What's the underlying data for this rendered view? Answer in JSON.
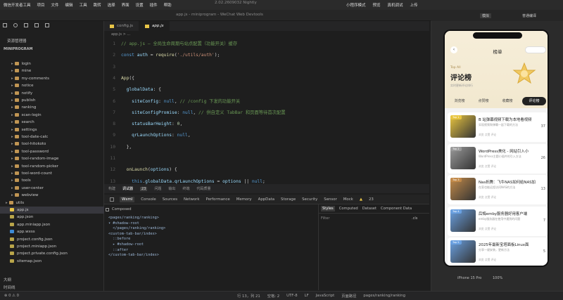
{
  "menubar": {
    "items": [
      "微信开发者工具",
      "项目",
      "文件",
      "编辑",
      "工具",
      "跳转",
      "选择",
      "界面",
      "设置",
      "插件",
      "帮助"
    ],
    "version": "2.02.2609032 Nightly",
    "right": [
      "小程序模式",
      "预览",
      "真机调试",
      "上传"
    ]
  },
  "titlebar": {
    "title": "app.js - miniprogram - WeChat Web Devtools"
  },
  "sim_header": {
    "mode": "模拟",
    "compile": "普通编译"
  },
  "explorer": {
    "title": "资源管理器",
    "root": "MINIPROGRAM",
    "items": [
      {
        "label": "login",
        "type": "folder"
      },
      {
        "label": "mine",
        "type": "folder"
      },
      {
        "label": "my-comments",
        "type": "folder"
      },
      {
        "label": "notice",
        "type": "folder"
      },
      {
        "label": "notify",
        "type": "folder"
      },
      {
        "label": "publish",
        "type": "folder"
      },
      {
        "label": "ranking",
        "type": "folder"
      },
      {
        "label": "scan-login",
        "type": "folder"
      },
      {
        "label": "search",
        "type": "folder"
      },
      {
        "label": "settings",
        "type": "folder"
      },
      {
        "label": "tool-date-calc",
        "type": "folder"
      },
      {
        "label": "tool-hitokoto",
        "type": "folder"
      },
      {
        "label": "tool-password",
        "type": "folder"
      },
      {
        "label": "tool-random-image",
        "type": "folder"
      },
      {
        "label": "tool-random-picker",
        "type": "folder"
      },
      {
        "label": "tool-word-count",
        "type": "folder"
      },
      {
        "label": "tools",
        "type": "folder"
      },
      {
        "label": "user-center",
        "type": "folder"
      },
      {
        "label": "webview",
        "type": "folder"
      },
      {
        "label": "utils",
        "type": "folder"
      },
      {
        "label": "app.js",
        "type": "file"
      },
      {
        "label": "app.json",
        "type": "json"
      },
      {
        "label": "app.miniapp.json",
        "type": "json"
      },
      {
        "label": "app.wxss",
        "type": "wxss"
      },
      {
        "label": "project.config.json",
        "type": "json"
      },
      {
        "label": "project.miniapp.json",
        "type": "json"
      },
      {
        "label": "project.private.config.json",
        "type": "json"
      },
      {
        "label": "sitemap.json",
        "type": "json"
      }
    ],
    "outline": "大纲",
    "timeline": "时间线"
  },
  "editor": {
    "tabs": [
      {
        "label": "config.js"
      },
      {
        "label": "app.js"
      }
    ],
    "breadcrumb": "app.js > ...",
    "lines": [
      {
        "n": "1",
        "parts": [
          [
            "c-com",
            "// app.js — 全局生命周期与站点配置（功能开关）缓存"
          ]
        ]
      },
      {
        "n": "2",
        "parts": [
          [
            "c-kw",
            "const "
          ],
          [
            "c-prop",
            "auth"
          ],
          [
            "c-txt",
            " = "
          ],
          [
            "c-fn",
            "require"
          ],
          [
            "c-txt",
            "("
          ],
          [
            "c-str",
            "'./utils/auth'"
          ],
          [
            "c-txt",
            ");"
          ]
        ]
      },
      {
        "n": "3",
        "parts": []
      },
      {
        "n": "4",
        "parts": [
          [
            "c-fn",
            "App"
          ],
          [
            "c-txt",
            "({"
          ]
        ]
      },
      {
        "n": "5",
        "parts": [
          [
            "c-txt",
            "  "
          ],
          [
            "c-prop",
            "globalData"
          ],
          [
            "c-txt",
            ": {"
          ]
        ]
      },
      {
        "n": "6",
        "parts": [
          [
            "c-txt",
            "    "
          ],
          [
            "c-prop",
            "siteConfig"
          ],
          [
            "c-txt",
            ": "
          ],
          [
            "c-kw",
            "null"
          ],
          [
            "c-txt",
            ", "
          ],
          [
            "c-com",
            "// /config 下发的功能开关"
          ]
        ]
      },
      {
        "n": "7",
        "parts": [
          [
            "c-txt",
            "    "
          ],
          [
            "c-prop",
            "siteConfigPromise"
          ],
          [
            "c-txt",
            ": "
          ],
          [
            "c-kw",
            "null"
          ],
          [
            "c-txt",
            ", "
          ],
          [
            "c-com",
            "// 供自定义 TabBar 和页面等待首次配置"
          ]
        ]
      },
      {
        "n": "8",
        "parts": [
          [
            "c-txt",
            "    "
          ],
          [
            "c-prop",
            "statusBarHeight"
          ],
          [
            "c-txt",
            ": "
          ],
          [
            "c-num",
            "0"
          ],
          [
            "c-txt",
            ","
          ]
        ]
      },
      {
        "n": "9",
        "parts": [
          [
            "c-txt",
            "    "
          ],
          [
            "c-prop",
            "qrLaunchOptions"
          ],
          [
            "c-txt",
            ": "
          ],
          [
            "c-kw",
            "null"
          ],
          [
            "c-txt",
            ","
          ]
        ]
      },
      {
        "n": "10",
        "parts": [
          [
            "c-txt",
            "  },"
          ]
        ]
      },
      {
        "n": "11",
        "parts": []
      },
      {
        "n": "12",
        "parts": [
          [
            "c-txt",
            "  "
          ],
          [
            "c-fn",
            "onLaunch"
          ],
          [
            "c-txt",
            "("
          ],
          [
            "c-prop",
            "options"
          ],
          [
            "c-txt",
            ") {"
          ]
        ]
      },
      {
        "n": "13",
        "parts": [
          [
            "c-txt",
            "    "
          ],
          [
            "c-kw",
            "this"
          ],
          [
            "c-txt",
            "."
          ],
          [
            "c-prop",
            "globalData"
          ],
          [
            "c-txt",
            "."
          ],
          [
            "c-prop",
            "qrLaunchOptions"
          ],
          [
            "c-txt",
            " = "
          ],
          [
            "c-prop",
            "options"
          ],
          [
            "c-txt",
            " || "
          ],
          [
            "c-kw",
            "null"
          ],
          [
            "c-txt",
            ";"
          ]
        ]
      }
    ]
  },
  "panel": {
    "tabs": [
      "构建",
      "调试器",
      "23",
      "问题",
      "输出",
      "终端",
      "代码质量"
    ],
    "devtabs": [
      "Wxml",
      "Console",
      "Sources",
      "Network",
      "Performance",
      "Memory",
      "AppData",
      "Storage",
      "Security",
      "Sensor",
      "Mock"
    ],
    "warn_count": "23",
    "composed": "Composed",
    "wxml_lines": [
      "<pages/ranking/ranking>",
      "▾ #shadow-root",
      "  </pages/ranking/ranking>",
      "<custom-tab-bar/index>",
      "  ::before",
      "  ▸ #shadow-root",
      "  ::after",
      "</custom-tab-bar/index>"
    ],
    "style_tabs": [
      "Styles",
      "Computed",
      "Dataset",
      "Component Data"
    ],
    "filter": "Filter",
    "cls": ".cls"
  },
  "statusbar": {
    "items": [
      "⊗ 0 ⚠ 0",
      "行 13，列 21",
      "空格: 2",
      "UTF-8",
      "LF",
      "JavaScript",
      "页面路径",
      "pages/ranking/ranking"
    ]
  },
  "phone": {
    "nav_title": "榜单",
    "hero_sub": "Top All",
    "hero_title": "评论榜",
    "hero_desc": "实时更新评论排行",
    "tabs": [
      "浏览榜",
      "点赞榜",
      "收藏榜",
      "评论榜"
    ],
    "cards": [
      {
        "badge": "Top 1",
        "title": "B 站弹幕视频下载为本地看视频",
        "desc": "实现视频和弹幕一起下载的方法",
        "meta": "浏览 点赞 评论",
        "num": "37",
        "color": "#e8c540"
      },
      {
        "badge": "Top 2",
        "title": "WordPress美化 - 网站引入小",
        "desc": "WordPress主题小插件的引入方法",
        "meta": "浏览 点赞 评论",
        "num": "26",
        "color": "#9a9a9a"
      },
      {
        "badge": "Top 3",
        "title": "Nas折腾：飞牛NAS如何给NAS加",
        "desc": "在家也能远程访问NAS的方法",
        "meta": "浏览 点赞 评论",
        "num": "13",
        "color": "#c28a4a"
      },
      {
        "badge": "Top 4",
        "title": "后悔emby服务器好用客户端",
        "desc": "emby服务器在使用中遇到的问题",
        "meta": "浏览 点赞 评论",
        "num": "7",
        "color": "#6aa0e0"
      },
      {
        "badge": "Top 5",
        "title": "2025年最新宝塔面板Linux面",
        "desc": "分享一键安装，更新方法",
        "meta": "浏览 点赞 评论",
        "num": "5",
        "color": "#6aa0e0"
      }
    ],
    "device": "iPhone 15 Pro",
    "zoom": "100%"
  }
}
